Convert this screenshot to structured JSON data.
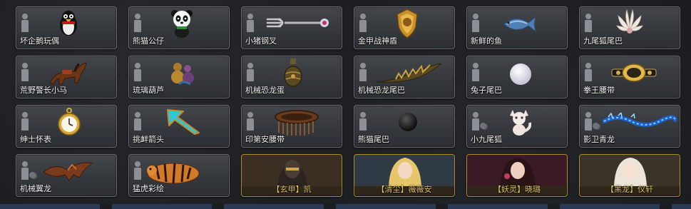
{
  "items": [
    {
      "label": "坏企鹅玩偶",
      "icon": "penguin-doll-icon"
    },
    {
      "label": "熊猫公仔",
      "icon": "panda-doll-icon"
    },
    {
      "label": "小猪钢叉",
      "icon": "pig-fork-icon"
    },
    {
      "label": "金甲战神盾",
      "icon": "golden-shield-icon"
    },
    {
      "label": "新鲜的鱼",
      "icon": "fresh-fish-icon"
    },
    {
      "label": "九尾狐尾巴",
      "icon": "nine-tail-icon"
    },
    {
      "label": "荒野警长小马",
      "icon": "pony-icon"
    },
    {
      "label": "琉璃葫芦",
      "icon": "glass-gourd-icon"
    },
    {
      "label": "机械恐龙蛋",
      "icon": "dino-egg-icon"
    },
    {
      "label": "机械恐龙尾巴",
      "icon": "dino-tail-icon"
    },
    {
      "label": "兔子尾巴",
      "icon": "rabbit-tail-icon"
    },
    {
      "label": "拳王腰带",
      "icon": "champion-belt-icon"
    },
    {
      "label": "绅士怀表",
      "icon": "pocket-watch-icon"
    },
    {
      "label": "挑衅箭头",
      "icon": "taunt-arrow-icon"
    },
    {
      "label": "印第安腰带",
      "icon": "indian-belt-icon"
    },
    {
      "label": "熊猫尾巴",
      "icon": "panda-tail-icon"
    },
    {
      "label": "小九尾狐",
      "icon": "little-fox-icon"
    },
    {
      "label": "影卫青龙",
      "icon": "azure-dragon-icon"
    },
    {
      "label": "机械翼龙",
      "icon": "pterodactyl-icon"
    },
    {
      "label": "猛虎彩绘",
      "icon": "tiger-paint-icon"
    }
  ],
  "heroes": [
    {
      "label": "【玄甲】凯",
      "icon": "hero-kai-portrait"
    },
    {
      "label": "【清尘】薇薇安",
      "icon": "hero-vivian-portrait"
    },
    {
      "label": "【妖灵】晓璐",
      "icon": "hero-xiaolu-portrait"
    },
    {
      "label": "【黑龙】仪轩",
      "icon": "hero-yixuan-portrait"
    }
  ],
  "colors": {
    "accent_gold": "#b08a2e",
    "label_gold": "#e0c46a",
    "frame": "#6a6c70"
  }
}
